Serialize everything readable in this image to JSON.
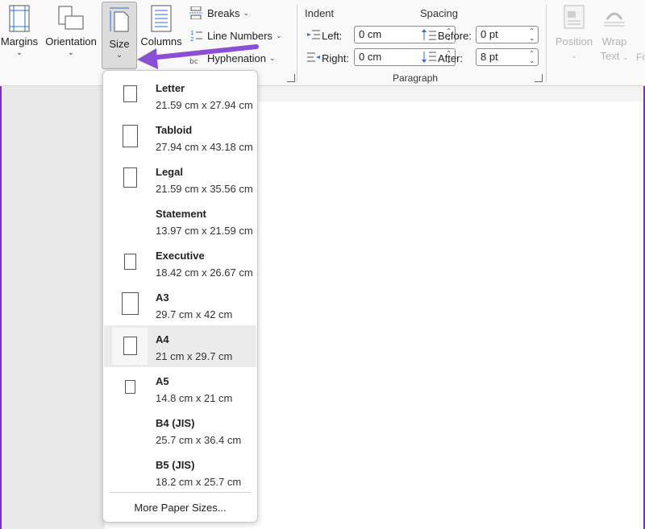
{
  "ribbon": {
    "margins": {
      "label": "Margins"
    },
    "orientation": {
      "label": "Orientation"
    },
    "size": {
      "label": "Size"
    },
    "columns": {
      "label": "Columns"
    },
    "breaks": {
      "label": "Breaks"
    },
    "line_numbers": {
      "label": "Line Numbers"
    },
    "hyphenation": {
      "label": "Hyphenation"
    },
    "paragraph": {
      "indent_header": "Indent",
      "spacing_header": "Spacing",
      "left_label": "Left:",
      "left_value": "0 cm",
      "right_label": "Right:",
      "right_value": "0 cm",
      "before_label": "Before:",
      "before_value": "0 pt",
      "after_label": "After:",
      "after_value": "8 pt",
      "group_label": "Paragraph"
    },
    "position": {
      "label": "Position"
    },
    "wrap": {
      "label1": "Wrap",
      "label2": "Text"
    },
    "cut_label": "Fo"
  },
  "size_menu": {
    "items": [
      {
        "name": "Letter",
        "dims": "21.59 cm x 27.94 cm"
      },
      {
        "name": "Tabloid",
        "dims": "27.94 cm x 43.18 cm"
      },
      {
        "name": "Legal",
        "dims": "21.59 cm x 35.56 cm"
      },
      {
        "name": "Statement",
        "dims": "13.97 cm x 21.59 cm"
      },
      {
        "name": "Executive",
        "dims": "18.42 cm x 26.67 cm"
      },
      {
        "name": "A3",
        "dims": "29.7 cm x 42 cm"
      },
      {
        "name": "A4",
        "dims": "21 cm x 29.7 cm"
      },
      {
        "name": "A5",
        "dims": "14.8 cm x 21 cm"
      },
      {
        "name": "B4 (JIS)",
        "dims": "25.7 cm x 36.4 cm"
      },
      {
        "name": "B5 (JIS)",
        "dims": "18.2 cm x 25.7 cm"
      }
    ],
    "selected": "A4",
    "more_label": "More Paper Sizes..."
  },
  "colors": {
    "annotation_arrow": "#8b4fd6",
    "frame": "#7b2fbe"
  }
}
